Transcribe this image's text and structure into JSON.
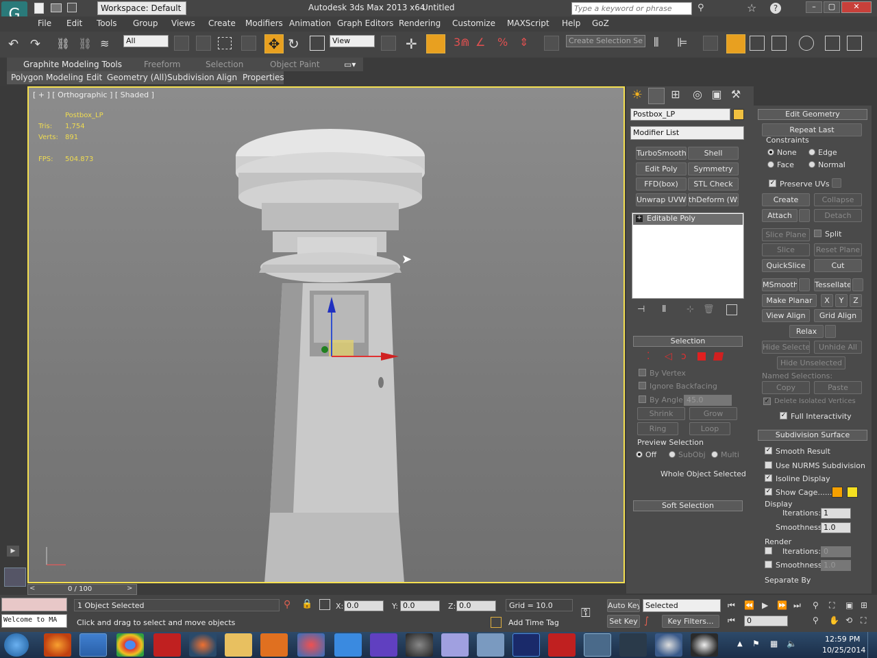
{
  "titlebar": {
    "workspace": "Workspace: Default",
    "app_title": "Autodesk 3ds Max  2013 x64",
    "file": "Untitled",
    "search_placeholder": "Type a keyword or phrase"
  },
  "menu": [
    "File",
    "Edit",
    "Tools",
    "Group",
    "Views",
    "Create",
    "Modifiers",
    "Animation",
    "Graph Editors",
    "Rendering",
    "Customize",
    "MAXScript",
    "Help",
    "GoZ"
  ],
  "toolbar": {
    "filter": "All",
    "ref_coord": "View",
    "selection_set": "Create Selection Se"
  },
  "ribbon_tabs": [
    "Graphite Modeling Tools",
    "Freeform",
    "Selection",
    "Object Paint"
  ],
  "ribbon_sub": [
    "Polygon Modeling",
    "Edit",
    "Geometry (All)",
    "Subdivision",
    "Align",
    "Properties"
  ],
  "viewport": {
    "label": "[ + ] [ Orthographic ] [ Shaded ]",
    "object": "Postbox_LP",
    "tris_label": "Tris:",
    "tris": "1,754",
    "verts_label": "Verts:",
    "verts": "891",
    "fps_label": "FPS:",
    "fps": "504.873"
  },
  "timeline": {
    "frame": "0 / 100"
  },
  "modify": {
    "object_name": "Postbox_LP",
    "modifier_list": "Modifier List",
    "buttons": [
      "TurboSmooth",
      "Shell",
      "Edit Poly",
      "Symmetry",
      "FFD(box)",
      "STL Check",
      "Unwrap UVW",
      "thDeform (WSI"
    ],
    "stack_item": "Editable Poly"
  },
  "selection_rollout": {
    "title": "Selection",
    "by_vertex": "By Vertex",
    "ignore_backfacing": "Ignore Backfacing",
    "by_angle": "By Angle:",
    "angle": "45.0",
    "shrink": "Shrink",
    "grow": "Grow",
    "ring": "Ring",
    "loop": "Loop",
    "preview": "Preview Selection",
    "off": "Off",
    "subobj": "SubObj",
    "multi": "Multi",
    "status": "Whole Object Selected",
    "soft": "Soft Selection"
  },
  "edit_geometry": {
    "title": "Edit Geometry",
    "repeat_last": "Repeat Last",
    "constraints": "Constraints",
    "none": "None",
    "edge": "Edge",
    "face": "Face",
    "normal": "Normal",
    "preserve_uvs": "Preserve UVs",
    "create": "Create",
    "collapse": "Collapse",
    "attach": "Attach",
    "detach": "Detach",
    "slice_plane": "Slice Plane",
    "split": "Split",
    "slice": "Slice",
    "reset_plane": "Reset Plane",
    "quickslice": "QuickSlice",
    "cut": "Cut",
    "msmooth": "MSmooth",
    "tessellate": "Tessellate",
    "make_planar": "Make Planar",
    "x": "X",
    "y": "Y",
    "z": "Z",
    "view_align": "View Align",
    "grid_align": "Grid Align",
    "relax": "Relax",
    "hide_selected": "Hide Selected",
    "unhide_all": "Unhide All",
    "hide_unselected": "Hide Unselected",
    "named_sel": "Named Selections:",
    "copy": "Copy",
    "paste": "Paste",
    "delete_isolated": "Delete Isolated Vertices",
    "full_interactivity": "Full Interactivity"
  },
  "subdivision": {
    "title": "Subdivision Surface",
    "smooth_result": "Smooth Result",
    "use_nurms": "Use NURMS Subdivision",
    "isoline": "Isoline Display",
    "show_cage": "Show Cage......",
    "display": "Display",
    "iterations": "Iterations:",
    "iter_val": "1",
    "smoothness": "Smoothness:",
    "smooth_val": "1.0",
    "render": "Render",
    "r_iter_val": "0",
    "r_smooth_val": "1.0",
    "separate_by": "Separate By",
    "cage_color1": "#f5a000",
    "cage_color2": "#f5e020"
  },
  "status": {
    "selected": "1 Object Selected",
    "prompt": "Click and drag to select and move objects",
    "x_label": "X:",
    "x": "0.0",
    "y_label": "Y:",
    "y": "0.0",
    "z_label": "Z:",
    "z": "0.0",
    "grid": "Grid = 10.0",
    "add_time_tag": "Add Time Tag",
    "auto_key": "Auto Key",
    "selected_dd": "Selected",
    "set_key": "Set Key",
    "key_filters": "Key Filters...",
    "frame": "0",
    "maxscript": "Welcome to MA"
  },
  "taskbar": {
    "time": "12:59 PM",
    "date": "10/25/2014"
  }
}
